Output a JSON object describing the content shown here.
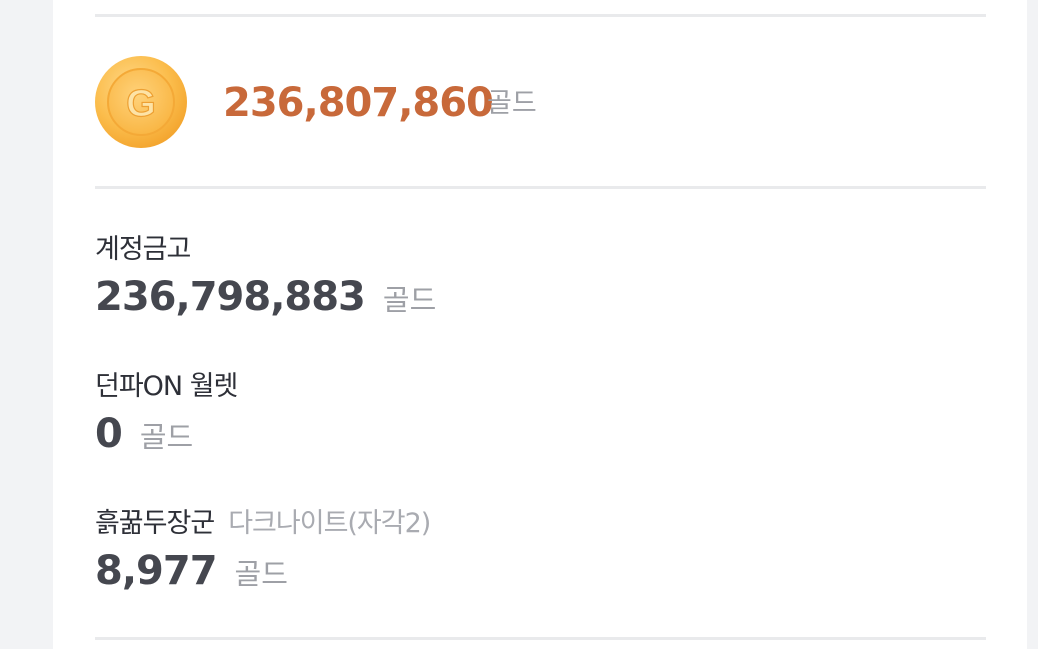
{
  "total": {
    "icon": "gold-coin-icon",
    "coin_letter": "G",
    "amount": "236,807,860",
    "unit": "골드"
  },
  "balances": [
    {
      "label": "계정금고",
      "sublabel": "",
      "amount": "236,798,883",
      "unit": "골드"
    },
    {
      "label": "던파ON 월렛",
      "sublabel": "",
      "amount": "0",
      "unit": "골드"
    },
    {
      "label": "흙꿂두장군",
      "sublabel": "다크나이트(자각2)",
      "amount": "8,977",
      "unit": "골드"
    }
  ],
  "colors": {
    "total_amount": "#c8693a",
    "amount": "#45474f",
    "unit": "#9ea0a6",
    "coin": "#f9b640"
  }
}
